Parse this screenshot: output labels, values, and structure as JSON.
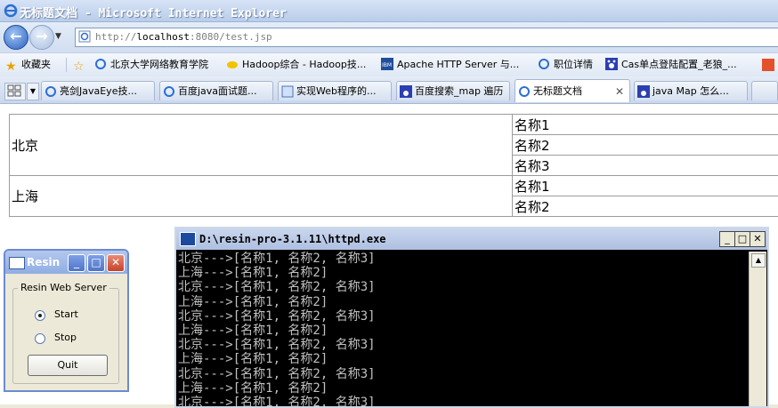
{
  "browser": {
    "title": "无标题文档 - Microsoft Internet Explorer",
    "url_prefix": "http://",
    "url_host": "localhost",
    "url_rest": ":8080/test.jsp"
  },
  "favorites": {
    "label": "收藏夹",
    "items": [
      {
        "label": "北京大学网络教育学院",
        "icon": "ie-page-icon"
      },
      {
        "label": "Hadoop综合 - Hadoop技...",
        "icon": "hadoop-icon"
      },
      {
        "label": "Apache HTTP Server 与...",
        "icon": "ibm-icon"
      },
      {
        "label": "职位详情",
        "icon": "ie-page-icon"
      },
      {
        "label": "Cas单点登陆配置_老狼_...",
        "icon": "paw-icon"
      }
    ]
  },
  "tabs": [
    {
      "label": "亮剑JavaEye技..."
    },
    {
      "label": "百度java面试题..."
    },
    {
      "label": "实现Web程序的..."
    },
    {
      "label": "百度搜索_map 遍历"
    },
    {
      "label": "无标题文档",
      "active": true
    },
    {
      "label": "java Map 怎么..."
    }
  ],
  "table": {
    "groups": [
      {
        "city": "北京",
        "names": [
          "名称1",
          "名称2",
          "名称3"
        ]
      },
      {
        "city": "上海",
        "names": [
          "名称1",
          "名称2"
        ]
      }
    ]
  },
  "resin": {
    "title": "Resin",
    "group_label": "Resin Web Server",
    "start_label": "Start",
    "stop_label": "Stop",
    "quit_label": "Quit",
    "selected": "Start"
  },
  "console": {
    "title": "D:\\resin-pro-3.1.11\\httpd.exe",
    "lines": [
      "北京--->[名称1, 名称2, 名称3]",
      "上海--->[名称1, 名称2]",
      "北京--->[名称1, 名称2, 名称3]",
      "上海--->[名称1, 名称2]",
      "北京--->[名称1, 名称2, 名称3]",
      "上海--->[名称1, 名称2]",
      "北京--->[名称1, 名称2, 名称3]",
      "上海--->[名称1, 名称2]",
      "北京--->[名称1, 名称2, 名称3]",
      "上海--->[名称1, 名称2]",
      "北京--->[名称1, 名称2, 名称3]"
    ]
  }
}
